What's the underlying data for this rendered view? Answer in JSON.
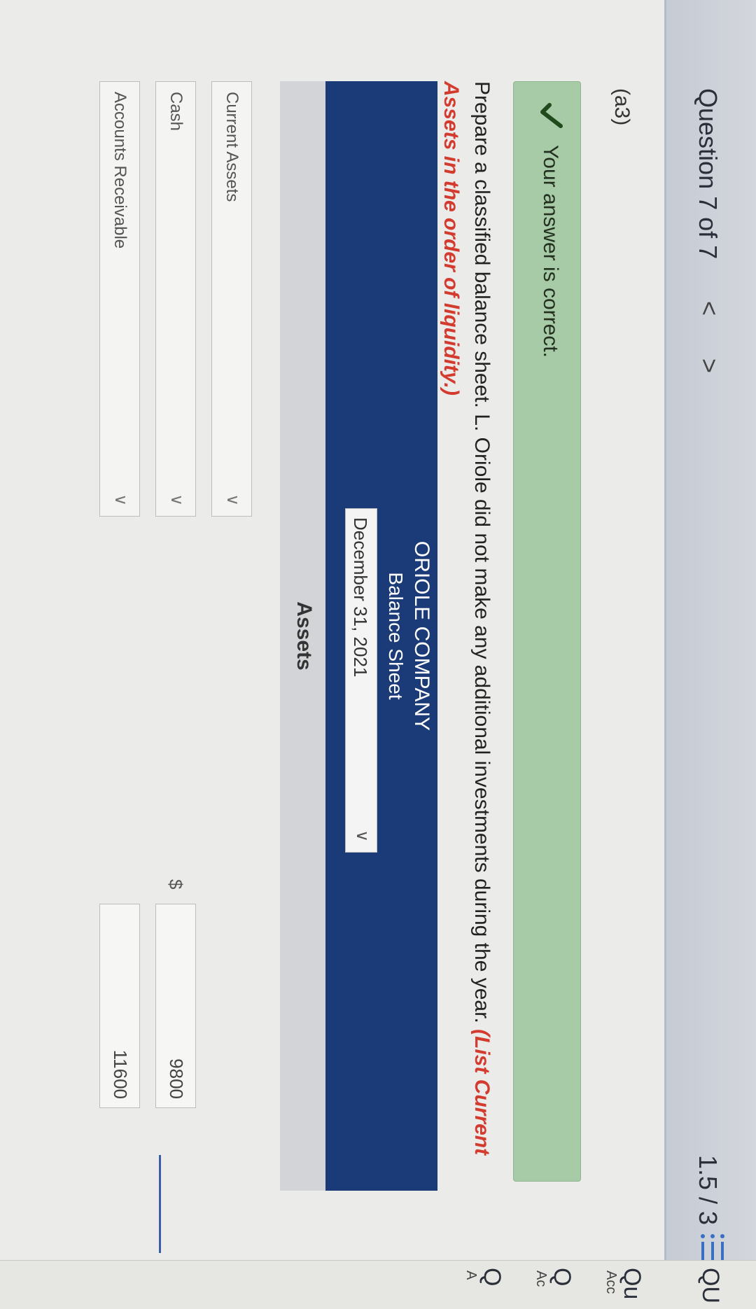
{
  "header": {
    "question_label": "Question 7 of 7",
    "prev": "<",
    "next": ">",
    "score": "1.5 / 3"
  },
  "right_panel": {
    "items": [
      {
        "title": "Qu",
        "sub": "Acc"
      },
      {
        "title": "Q",
        "sub": "Ac"
      },
      {
        "title": "Q",
        "sub": "A"
      }
    ],
    "top_label": "QU"
  },
  "part_label": "(a3)",
  "feedback": {
    "text": "Your answer is correct."
  },
  "instruction": {
    "text": "Prepare a classified balance sheet. L. Oriole did not make any additional investments during the year.",
    "note": "(List Current Assets in the order of liquidity.)"
  },
  "balance_sheet": {
    "company": "ORIOLE COMPANY",
    "title": "Balance Sheet",
    "date": "December 31, 2021",
    "section": "Assets",
    "rows": [
      {
        "label": "Current Assets",
        "currency": "",
        "amount": ""
      },
      {
        "label": "Cash",
        "currency": "$",
        "amount": "9800"
      },
      {
        "label": "Accounts Receivable",
        "currency": "",
        "amount": "11600"
      }
    ]
  },
  "colors": {
    "header_block": "#1b3a78",
    "correct_bg": "#a8cba7",
    "note_red": "#d43b2f"
  },
  "icons": [
    "chevron-left-icon",
    "chevron-right-icon",
    "list-icon",
    "check-icon",
    "chevron-down-icon"
  ]
}
